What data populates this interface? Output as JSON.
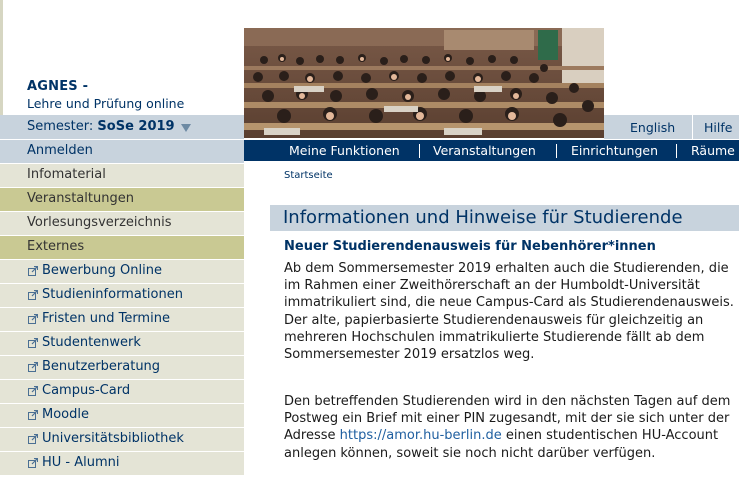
{
  "brand": {
    "title": "AGNES -",
    "subtitle": "Lehre und Prüfung online"
  },
  "semester": {
    "label": "Semester:",
    "value": "SoSe 2019"
  },
  "language_bar": {
    "english": "English",
    "help": "Hilfe"
  },
  "sidebar": {
    "items": [
      {
        "label": "Anmelden",
        "kind": "login"
      },
      {
        "label": "Infomaterial",
        "kind": "plain"
      },
      {
        "label": "Veranstaltungen",
        "kind": "highlight"
      },
      {
        "label": "Vorlesungsverzeichnis",
        "kind": "plain"
      },
      {
        "label": "Externes",
        "kind": "highlight"
      },
      {
        "label": "Bewerbung Online",
        "kind": "external"
      },
      {
        "label": "Studieninformationen",
        "kind": "external"
      },
      {
        "label": "Fristen und Termine",
        "kind": "external"
      },
      {
        "label": "Studentenwerk",
        "kind": "external"
      },
      {
        "label": "Benutzerberatung",
        "kind": "external"
      },
      {
        "label": "Campus-Card",
        "kind": "external"
      },
      {
        "label": "Moodle",
        "kind": "external"
      },
      {
        "label": "Universitätsbibliothek",
        "kind": "external"
      },
      {
        "label": "HU - Alumni",
        "kind": "external"
      }
    ]
  },
  "main_menu": {
    "items": [
      "Meine Funktionen",
      "Veranstaltungen",
      "Einrichtungen",
      "Räume"
    ]
  },
  "breadcrumb": "Startseite",
  "content": {
    "title": "Informationen und Hinweise für Studierende",
    "article_heading": "Neuer Studierendenausweis für Nebenhörer*innen",
    "paragraph1": "Ab dem Sommersemester 2019 erhalten auch die Studierenden, die im Rahmen einer Zweithörerschaft an der Humboldt-Universität immatrikuliert sind, die neue Campus-Card als Studierendenausweis. Der alte, papierbasierte Studierendenausweis für gleichzeitig an mehreren Hochschulen immatrikulierte Studierende fällt ab dem Sommersemester 2019 ersatzlos weg.",
    "paragraph2_before": "Den betreffenden Studierenden wird in den nächsten Tagen auf dem Postweg ein Brief mit einer PIN zugesandt, mit der sie sich unter der Adresse ",
    "paragraph2_link": "https://amor.hu-berlin.de",
    "paragraph2_after": " einen studentischen HU-Account anlegen können, soweit sie noch nicht darüber verfügen."
  },
  "colors": {
    "navy": "#003366",
    "pale_blue": "#c8d3dd",
    "beige": "#e4e4d6",
    "olive": "#c9c993",
    "link": "#1f5fa0"
  },
  "icons": {
    "external_link": "external-link-icon",
    "dropdown": "triangle-down-icon"
  }
}
